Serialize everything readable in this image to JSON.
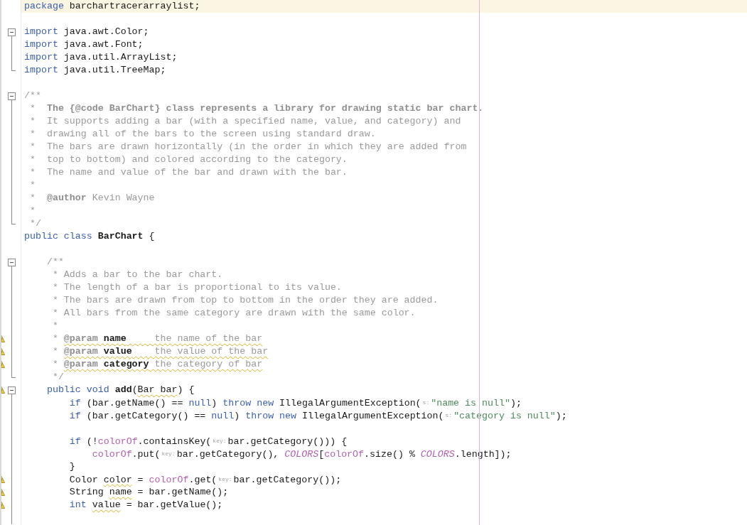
{
  "editor": {
    "lines": [
      {
        "highlighted": true,
        "warning": false,
        "fold_start": false,
        "fold_end": false,
        "tokens": [
          {
            "text": "package",
            "kind": "keyword"
          },
          {
            "text": " barchartracerarraylist;",
            "kind": "plain"
          }
        ]
      },
      {
        "highlighted": false,
        "warning": false,
        "fold_start": false,
        "fold_end": false
      },
      {
        "highlighted": false,
        "warning": false,
        "fold_start": true,
        "fold_end": false,
        "tokens": [
          {
            "text": "import",
            "kind": "keyword"
          },
          {
            "text": " java.awt.Color;",
            "kind": "plain"
          }
        ]
      },
      {
        "highlighted": false,
        "warning": false,
        "fold_start": false,
        "fold_end": false,
        "tokens": [
          {
            "text": "import",
            "kind": "keyword"
          },
          {
            "text": " java.awt.Font;",
            "kind": "plain"
          }
        ]
      },
      {
        "highlighted": false,
        "warning": false,
        "fold_start": false,
        "fold_end": false,
        "tokens": [
          {
            "text": "import",
            "kind": "keyword"
          },
          {
            "text": " java.util.ArrayList;",
            "kind": "plain"
          }
        ]
      },
      {
        "highlighted": false,
        "warning": false,
        "fold_start": false,
        "fold_end": true,
        "tokens": [
          {
            "text": "import",
            "kind": "keyword"
          },
          {
            "text": " java.util.TreeMap;",
            "kind": "plain"
          }
        ]
      },
      {
        "highlighted": false,
        "warning": false,
        "fold_start": false,
        "fold_end": false
      },
      {
        "highlighted": false,
        "warning": false,
        "fold_start": true,
        "fold_end": false,
        "tokens": [
          {
            "text": "/**",
            "kind": "comment"
          }
        ]
      },
      {
        "highlighted": false,
        "warning": false,
        "fold_start": false,
        "fold_end": false,
        "tokens": [
          {
            "text": " *  ",
            "kind": "comment"
          },
          {
            "text": "The {@code BarChart} class represents a library for drawing static bar chart.",
            "kind": "comment-bold"
          }
        ]
      },
      {
        "highlighted": false,
        "warning": false,
        "fold_start": false,
        "fold_end": false,
        "tokens": [
          {
            "text": " *  It supports adding a bar (with a specified name, value, and category) and",
            "kind": "comment"
          }
        ]
      },
      {
        "highlighted": false,
        "warning": false,
        "fold_start": false,
        "fold_end": false,
        "tokens": [
          {
            "text": " *  drawing all of the bars to the screen using standard draw.",
            "kind": "comment"
          }
        ]
      },
      {
        "highlighted": false,
        "warning": false,
        "fold_start": false,
        "fold_end": false,
        "tokens": [
          {
            "text": " *  The bars are drawn horizontally (in the order in which they are added from",
            "kind": "comment"
          }
        ]
      },
      {
        "highlighted": false,
        "warning": false,
        "fold_start": false,
        "fold_end": false,
        "tokens": [
          {
            "text": " *  top to bottom) and colored according to the category.",
            "kind": "comment"
          }
        ]
      },
      {
        "highlighted": false,
        "warning": false,
        "fold_start": false,
        "fold_end": false,
        "tokens": [
          {
            "text": " *  The name and value of the bar and drawn with the bar.",
            "kind": "comment"
          }
        ]
      },
      {
        "highlighted": false,
        "warning": false,
        "fold_start": false,
        "fold_end": false,
        "tokens": [
          {
            "text": " *",
            "kind": "comment"
          }
        ]
      },
      {
        "highlighted": false,
        "warning": false,
        "fold_start": false,
        "fold_end": false,
        "tokens": [
          {
            "text": " *  ",
            "kind": "comment"
          },
          {
            "text": "@author",
            "kind": "doc-tag"
          },
          {
            "text": " Kevin Wayne",
            "kind": "comment"
          }
        ]
      },
      {
        "highlighted": false,
        "warning": false,
        "fold_start": false,
        "fold_end": false,
        "tokens": [
          {
            "text": " *",
            "kind": "comment"
          }
        ]
      },
      {
        "highlighted": false,
        "warning": false,
        "fold_start": false,
        "fold_end": true,
        "tokens": [
          {
            "text": " */",
            "kind": "comment"
          }
        ]
      },
      {
        "highlighted": false,
        "warning": false,
        "fold_start": false,
        "fold_end": false,
        "tokens": [
          {
            "text": "public class ",
            "kind": "keyword"
          },
          {
            "text": "BarChart",
            "kind": "bold"
          },
          {
            "text": " {",
            "kind": "plain"
          }
        ]
      },
      {
        "highlighted": false,
        "warning": false,
        "fold_start": false,
        "fold_end": false
      },
      {
        "highlighted": false,
        "warning": false,
        "fold_start": true,
        "fold_end": false,
        "tokens": [
          {
            "text": "    /**",
            "kind": "comment"
          }
        ]
      },
      {
        "highlighted": false,
        "warning": false,
        "fold_start": false,
        "fold_end": false,
        "tokens": [
          {
            "text": "     * Adds a bar to the bar chart.",
            "kind": "comment"
          }
        ]
      },
      {
        "highlighted": false,
        "warning": false,
        "fold_start": false,
        "fold_end": false,
        "tokens": [
          {
            "text": "     * The length of a bar is proportional to its value.",
            "kind": "comment"
          }
        ]
      },
      {
        "highlighted": false,
        "warning": false,
        "fold_start": false,
        "fold_end": false,
        "tokens": [
          {
            "text": "     * The bars are drawn from top to bottom in the order they are added.",
            "kind": "comment"
          }
        ]
      },
      {
        "highlighted": false,
        "warning": false,
        "fold_start": false,
        "fold_end": false,
        "tokens": [
          {
            "text": "     * All bars from the same category are drawn with the same color.",
            "kind": "comment"
          }
        ]
      },
      {
        "highlighted": false,
        "warning": false,
        "fold_start": false,
        "fold_end": false,
        "tokens": [
          {
            "text": "     *",
            "kind": "comment"
          }
        ]
      },
      {
        "highlighted": false,
        "warning": true,
        "fold_start": false,
        "fold_end": false,
        "tokens": [
          {
            "text": "     * ",
            "kind": "comment"
          },
          {
            "text": "@param ",
            "kind": "doc-tag",
            "squiggle": true
          },
          {
            "text": "name",
            "kind": "doc-param",
            "squiggle": true
          },
          {
            "text": "     the name of the bar",
            "kind": "comment",
            "squiggle": true
          }
        ]
      },
      {
        "highlighted": false,
        "warning": true,
        "fold_start": false,
        "fold_end": false,
        "tokens": [
          {
            "text": "     * ",
            "kind": "comment"
          },
          {
            "text": "@param ",
            "kind": "doc-tag",
            "squiggle": true
          },
          {
            "text": "value",
            "kind": "doc-param",
            "squiggle": true
          },
          {
            "text": "    the value of the bar",
            "kind": "comment",
            "squiggle": true
          }
        ]
      },
      {
        "highlighted": false,
        "warning": true,
        "fold_start": false,
        "fold_end": false,
        "tokens": [
          {
            "text": "     * ",
            "kind": "comment"
          },
          {
            "text": "@param ",
            "kind": "doc-tag",
            "squiggle": true
          },
          {
            "text": "category",
            "kind": "doc-param",
            "squiggle": true
          },
          {
            "text": " the category of bar",
            "kind": "comment",
            "squiggle": true
          }
        ]
      },
      {
        "highlighted": false,
        "warning": false,
        "fold_start": false,
        "fold_end": true,
        "tokens": [
          {
            "text": "     */",
            "kind": "comment"
          }
        ]
      },
      {
        "highlighted": false,
        "warning": true,
        "fold_start": true,
        "fold_end": false,
        "tokens": [
          {
            "text": "    public void ",
            "kind": "keyword"
          },
          {
            "text": "add",
            "kind": "bold"
          },
          {
            "text": "(",
            "kind": "plain"
          },
          {
            "text": "Bar bar",
            "kind": "plain",
            "squiggle": true
          },
          {
            "text": ") {",
            "kind": "plain"
          }
        ]
      },
      {
        "highlighted": false,
        "warning": false,
        "fold_start": false,
        "fold_end": false,
        "tokens": [
          {
            "text": "        if",
            "kind": "keyword"
          },
          {
            "text": " (bar.getName() == ",
            "kind": "plain"
          },
          {
            "text": "null",
            "kind": "keyword"
          },
          {
            "text": ") ",
            "kind": "plain"
          },
          {
            "text": "throw new",
            "kind": "keyword"
          },
          {
            "text": " IllegalArgumentException(",
            "kind": "plain"
          },
          {
            "text": "s:",
            "kind": "hint"
          },
          {
            "text": "\"name is null\"",
            "kind": "string"
          },
          {
            "text": ");",
            "kind": "plain"
          }
        ]
      },
      {
        "highlighted": false,
        "warning": false,
        "fold_start": false,
        "fold_end": false,
        "tokens": [
          {
            "text": "        if",
            "kind": "keyword"
          },
          {
            "text": " (bar.getCategory() == ",
            "kind": "plain"
          },
          {
            "text": "null",
            "kind": "keyword"
          },
          {
            "text": ") ",
            "kind": "plain"
          },
          {
            "text": "throw new",
            "kind": "keyword"
          },
          {
            "text": " IllegalArgumentException(",
            "kind": "plain"
          },
          {
            "text": "s:",
            "kind": "hint"
          },
          {
            "text": "\"category is null\"",
            "kind": "string"
          },
          {
            "text": ");",
            "kind": "plain"
          }
        ]
      },
      {
        "highlighted": false,
        "warning": false,
        "fold_start": false,
        "fold_end": false
      },
      {
        "highlighted": false,
        "warning": false,
        "fold_start": false,
        "fold_end": false,
        "tokens": [
          {
            "text": "        if",
            "kind": "keyword"
          },
          {
            "text": " (!",
            "kind": "plain"
          },
          {
            "text": "colorOf",
            "kind": "field"
          },
          {
            "text": ".containsKey(",
            "kind": "plain"
          },
          {
            "text": "key:",
            "kind": "hint"
          },
          {
            "text": "bar.getCategory())) {",
            "kind": "plain"
          }
        ]
      },
      {
        "highlighted": false,
        "warning": false,
        "fold_start": false,
        "fold_end": false,
        "tokens": [
          {
            "text": "            colorOf",
            "kind": "field"
          },
          {
            "text": ".put(",
            "kind": "plain"
          },
          {
            "text": "key:",
            "kind": "hint"
          },
          {
            "text": "bar.getCategory(), ",
            "kind": "plain"
          },
          {
            "text": "COLORS",
            "kind": "static-field"
          },
          {
            "text": "[",
            "kind": "plain"
          },
          {
            "text": "colorOf",
            "kind": "field"
          },
          {
            "text": ".size() % ",
            "kind": "plain"
          },
          {
            "text": "COLORS",
            "kind": "static-field"
          },
          {
            "text": ".length]);",
            "kind": "plain"
          }
        ]
      },
      {
        "highlighted": false,
        "warning": false,
        "fold_start": false,
        "fold_end": false,
        "tokens": [
          {
            "text": "        }",
            "kind": "plain"
          }
        ]
      },
      {
        "highlighted": false,
        "warning": true,
        "fold_start": false,
        "fold_end": false,
        "tokens": [
          {
            "text": "        Color ",
            "kind": "plain"
          },
          {
            "text": "color",
            "kind": "plain",
            "squiggle": true
          },
          {
            "text": " = ",
            "kind": "plain"
          },
          {
            "text": "colorOf",
            "kind": "field"
          },
          {
            "text": ".get(",
            "kind": "plain"
          },
          {
            "text": "key:",
            "kind": "hint"
          },
          {
            "text": "bar.getCategory());",
            "kind": "plain"
          }
        ]
      },
      {
        "highlighted": false,
        "warning": true,
        "fold_start": false,
        "fold_end": false,
        "tokens": [
          {
            "text": "        String ",
            "kind": "plain"
          },
          {
            "text": "name",
            "kind": "plain",
            "squiggle": true
          },
          {
            "text": " = bar.getName();",
            "kind": "plain"
          }
        ]
      },
      {
        "highlighted": false,
        "warning": true,
        "fold_start": false,
        "fold_end": false,
        "tokens": [
          {
            "text": "        int ",
            "kind": "keyword"
          },
          {
            "text": "value",
            "kind": "plain",
            "squiggle": true
          },
          {
            "text": " = bar.getValue();",
            "kind": "plain"
          }
        ]
      },
      {
        "highlighted": false,
        "warning": false,
        "fold_start": false,
        "fold_end": false
      }
    ]
  }
}
